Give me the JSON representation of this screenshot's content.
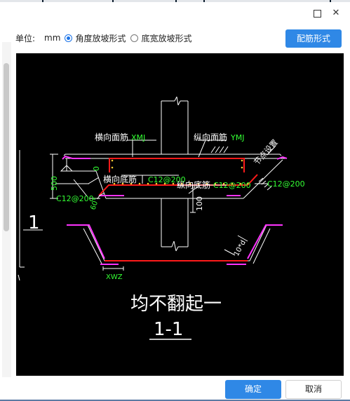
{
  "window": {
    "maximize_glyph": "☐",
    "close_glyph": "✕"
  },
  "toolbar": {
    "unit_label": "单位:",
    "unit_value": "mm",
    "options": [
      {
        "label": "角度放坡形式",
        "checked": true
      },
      {
        "label": "底宽放坡形式",
        "checked": false
      }
    ],
    "rebar_button": "配筋形式"
  },
  "drawing": {
    "labels": {
      "top_transverse": "横向面筋",
      "top_transverse_code": "XMJ",
      "top_longitudinal": "纵向面筋",
      "top_longitudinal_code": "YMJ",
      "node_setting": "节点设置",
      "zero": "0",
      "dim_500": "500",
      "bottom_transverse": "横向底筋",
      "bottom_transverse_spec": "C12@200",
      "bottom_longitudinal": "纵向底筋",
      "bottom_longitudinal_spec": "C12@200",
      "left_spec": "C12@200",
      "right_spec": "C12@200",
      "angle": "60°",
      "dim_100": "100",
      "ten_d": "10*d",
      "xwz": "XWZ",
      "caption": "均不翻起一",
      "section": "1-1"
    },
    "side_text": "1"
  },
  "footer": {
    "ok": "确定",
    "cancel": "取消"
  },
  "colors": {
    "accent": "#2f88e6",
    "rebar_red": "#ff1a1a",
    "rebar_magenta": "#ff33ff",
    "dim_green": "#33ff33",
    "outline_white": "#ffffff",
    "canvas_bg": "#000000"
  }
}
